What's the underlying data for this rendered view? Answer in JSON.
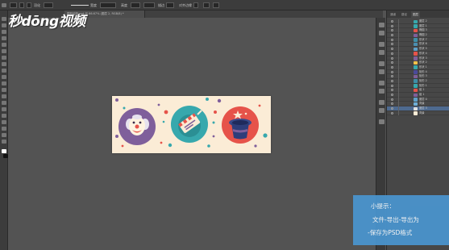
{
  "logo": {
    "text": "秒dōng视频"
  },
  "document": {
    "tab_title": "图形绘制.psd @ 66.67% (图层 2, RGB/8) *"
  },
  "options": {
    "labels": [
      "羽化",
      "宽度",
      "高度",
      "对齐边缘",
      "半径",
      "描边",
      "形状",
      "填充"
    ]
  },
  "panel": {
    "tabs": [
      "通道",
      "路径",
      "图层"
    ],
    "active_tab": "图层",
    "layers": [
      {
        "name": "图层 2",
        "thumb": "#37a8ad",
        "selected": false
      },
      {
        "name": "图层 1",
        "thumb": "#37a8ad",
        "selected": false
      },
      {
        "name": "椭圆 3",
        "thumb": "#e6534a",
        "selected": false
      },
      {
        "name": "椭圆 2",
        "thumb": "#7f5f9b",
        "selected": false
      },
      {
        "name": "形状 7",
        "thumb": "#3e8fa8",
        "selected": false
      },
      {
        "name": "形状 6",
        "thumb": "#4b8fb0",
        "selected": false
      },
      {
        "name": "形状 5",
        "thumb": "#5fa0c8",
        "selected": false
      },
      {
        "name": "形状 4",
        "thumb": "#e6534a",
        "selected": false
      },
      {
        "name": "形状 3",
        "thumb": "#7f5f9b",
        "selected": false
      },
      {
        "name": "形状 2",
        "thumb": "#f2c14b",
        "selected": false
      },
      {
        "name": "形状 1",
        "thumb": "#37a8ad",
        "selected": false
      },
      {
        "name": "矩形 4",
        "thumb": "#4b4b9b",
        "selected": false
      },
      {
        "name": "矩形 3",
        "thumb": "#7f5f9b",
        "selected": false
      },
      {
        "name": "矩形 2",
        "thumb": "#3e8fa8",
        "selected": false
      },
      {
        "name": "矩形 1",
        "thumb": "#37a8ad",
        "selected": false
      },
      {
        "name": "组 2",
        "thumb": "#e6534a",
        "selected": false
      },
      {
        "name": "组 1",
        "thumb": "#7f5f9b",
        "selected": false
      },
      {
        "name": "图层 0",
        "thumb": "#5fa0c8",
        "selected": false
      },
      {
        "name": "背景",
        "thumb": "#6fb0d8",
        "selected": false
      },
      {
        "name": "图层 3",
        "thumb": "#e0e0e0",
        "selected": true
      },
      {
        "name": "背景",
        "thumb": "#fbecd6",
        "selected": false
      }
    ]
  },
  "tip": {
    "title": "小提示：",
    "line1": "文件-导出-导出为",
    "line2": "-保存为PSD格式"
  },
  "colors": {
    "canvas_bg": "#fbecd6",
    "purple": "#7f5f9b",
    "teal": "#37a8ad",
    "red": "#e6534a",
    "tip_bg": "#4a95cf"
  }
}
